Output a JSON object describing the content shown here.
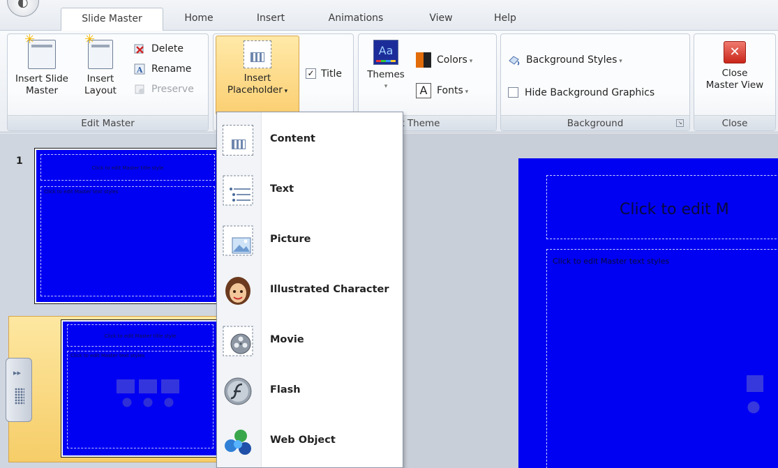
{
  "tabs": [
    {
      "label": "Slide Master",
      "active": true
    },
    {
      "label": "Home"
    },
    {
      "label": "Insert"
    },
    {
      "label": "Animations"
    },
    {
      "label": "View"
    },
    {
      "label": "Help"
    }
  ],
  "ribbon": {
    "edit_master": {
      "label": "Edit Master",
      "insert_slide_master": "Insert Slide\nMaster",
      "insert_layout": "Insert\nLayout",
      "delete": "Delete",
      "rename": "Rename",
      "preserve": "Preserve"
    },
    "master_layout": {
      "insert_placeholder_1": "Insert",
      "insert_placeholder_2": "Placeholder",
      "title_check": "Title",
      "title_checked": true
    },
    "edit_theme": {
      "label": "dit Theme",
      "themes": "Themes",
      "colors": "Colors",
      "fonts": "Fonts",
      "themes_icon_text": "Aa"
    },
    "background": {
      "label": "Background",
      "background_styles": "Background Styles",
      "hide_bg_graphics": "Hide Background Graphics"
    },
    "close": {
      "label": "Close",
      "close_master_1": "Close",
      "close_master_2": "Master View"
    }
  },
  "dropdown": {
    "items": [
      {
        "label": "Content",
        "icon": "content-placeholder-icon"
      },
      {
        "label": "Text",
        "icon": "text-placeholder-icon"
      },
      {
        "label": "Picture",
        "icon": "picture-placeholder-icon"
      },
      {
        "label": "Illustrated Character",
        "icon": "character-icon"
      },
      {
        "label": "Movie",
        "icon": "movie-icon"
      },
      {
        "label": "Flash",
        "icon": "flash-icon"
      },
      {
        "label": "Web Object",
        "icon": "web-object-icon"
      }
    ]
  },
  "slides": {
    "number": "1",
    "thumb1_title": "Click to edit Master title style",
    "thumb1_text": "Click to edit Master text styles",
    "thumb2_title": "Click to edit Master title style",
    "thumb2_text": "Click to edit Master text styles"
  },
  "main_slide": {
    "title": "Click to edit M",
    "body": "Click to edit Master text styles"
  },
  "colors": {
    "slide_bg": "#0000f2",
    "active_button": "#fbd27a",
    "accent": "#f3a020"
  }
}
